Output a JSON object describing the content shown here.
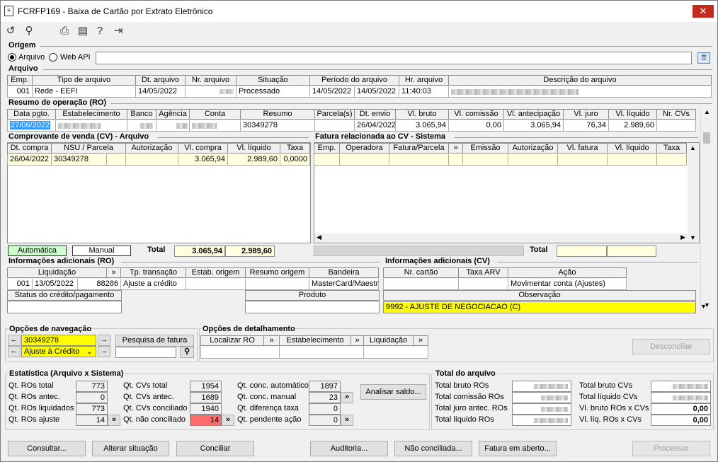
{
  "window": {
    "title": "FCRFP169 - Baixa de Cartão por Extrato Eletrônico",
    "close": "✕"
  },
  "origem": {
    "title": "Origem",
    "opt1": "Arquivo",
    "opt2": "Web API"
  },
  "arquivo": {
    "title": "Arquivo",
    "cols": [
      "Emp.",
      "Tipo de arquivo",
      "Dt. arquivo",
      "Nr. arquivo",
      "Situação",
      "Período do arquivo",
      "Hr. arquivo",
      "Descrição do arquivo"
    ],
    "row": {
      "emp": "001",
      "tipo": "Rede - EEFI",
      "dt": "14/05/2022",
      "situacao": "Processado",
      "per1": "14/05/2022",
      "per2": "14/05/2022",
      "hr": "11:40:03"
    }
  },
  "ro": {
    "title": "Resumo de operação (RO)",
    "cols": [
      "Data pgto.",
      "Estabelecimento",
      "Banco",
      "Agência",
      "Conta",
      "Resumo",
      "Parcela(s)",
      "Dt. envio",
      "Vl. bruto",
      "Vl. comissão",
      "Vl. antecipação",
      "Vl. juro",
      "Vl. líquido",
      "Nr. CVs"
    ],
    "row": {
      "data": "27/06/2022",
      "resumo": "30349278",
      "dtenvio": "26/04/2022",
      "bruto": "3.065,94",
      "comissao": "0,00",
      "antecip": "3.065,94",
      "juro": "76,34",
      "liquido": "2.989,60"
    }
  },
  "cv": {
    "title": "Comprovante de venda (CV) - Arquivo",
    "cols": [
      "Dt. compra",
      "NSU / Parcela",
      "Autorização",
      "Vl. compra",
      "Vl. líquido",
      "Taxa"
    ],
    "row": {
      "dt": "26/04/2022",
      "nsu": "30349278",
      "compra": "3.065,94",
      "liquido": "2.989,60",
      "taxa": "0,0000"
    },
    "auto": "Automática",
    "manual": "Manual",
    "total_label": "Total",
    "total_compra": "3.065,94",
    "total_liquido": "2.989,60"
  },
  "fatura": {
    "title": "Fatura relacionada ao CV - Sistema",
    "cols": [
      "Emp.",
      "Operadora",
      "Fatura/Parcela",
      "»",
      "Emissão",
      "Autorização",
      "Vl. fatura",
      "Vl. líquido",
      "Taxa"
    ],
    "total_label": "Total"
  },
  "info_ro": {
    "title": "Informações adicionais (RO)",
    "cols": [
      "Liquidação",
      "»",
      "Tp. transação",
      "Estab. origem",
      "Resumo origem",
      "Bandeira"
    ],
    "row": {
      "emp": "001",
      "data": "13/05/2022",
      "num": "88286",
      "tp": "Ajuste a crédito",
      "bandeira": "MasterCard/Maestr"
    },
    "status": "Status do crédito/pagamento",
    "produto": "Produto"
  },
  "info_cv": {
    "title": "Informações adicionais (CV)",
    "cols": [
      "Nr. cartão",
      "Taxa ARV",
      "Ação"
    ],
    "acao": "Movimentar conta (Ajustes)",
    "obs_label": "Observação",
    "obs": "9992 - AJUSTE DE NEGOCIACAO (C)"
  },
  "nav": {
    "title": "Opções de navegação",
    "value": "30349278",
    "select": "Ajuste à Crédito",
    "pesquisa": "Pesquisa de fatura"
  },
  "detal": {
    "title": "Opções de detalhamento",
    "b1": "Localizar RO",
    "b2": "Estabelecimento",
    "b3": "Liquidação",
    "desconciliar": "Desconciliar"
  },
  "stats": {
    "title": "Estatística (Arquivo x Sistema)",
    "c1": [
      [
        "Qt. ROs total",
        "773"
      ],
      [
        "Qt. ROs antec.",
        "0"
      ],
      [
        "Qt. ROs liquidados",
        "773"
      ],
      [
        "Qt. ROs ajuste",
        "14"
      ]
    ],
    "c2": [
      [
        "Qt. CVs total",
        "1954"
      ],
      [
        "Qt. CVs antec.",
        "1689"
      ],
      [
        "Qt. CVs conciliado",
        "1940"
      ],
      [
        "Qt. não conciliado",
        "14"
      ]
    ],
    "c3": [
      [
        "Qt. conc. automático",
        "1897"
      ],
      [
        "Qt. conc. manual",
        "23"
      ],
      [
        "Qt. diferença taxa",
        "0"
      ],
      [
        "Qt. pendente ação",
        "0"
      ]
    ],
    "analisar": "Analisar saldo..."
  },
  "total": {
    "title": "Total do arquivo",
    "l1": [
      "Total bruto ROs",
      "Total comissão ROs",
      "Total juro antec. ROs",
      "Total líquido ROs"
    ],
    "l2": [
      "Total bruto CVs",
      "Total líquido CVs",
      "Vl. bruto ROs x CVs",
      "Vl. líq. ROs x CVs"
    ],
    "v3": "0,00",
    "v4": "0,00"
  },
  "buttons": {
    "consultar": "Consultar...",
    "alterar": "Alterar situação",
    "conciliar": "Conciliar",
    "auditoria": "Auditoria...",
    "nao": "Não conciliada...",
    "fatura": "Fatura em aberto...",
    "processar": "Processar"
  },
  "colors": {
    "yellow": "#ffff00",
    "lightyellow": "#ffffe0",
    "green": "#ccffcc",
    "red": "#ff6b6b",
    "select": "#3399ff"
  }
}
